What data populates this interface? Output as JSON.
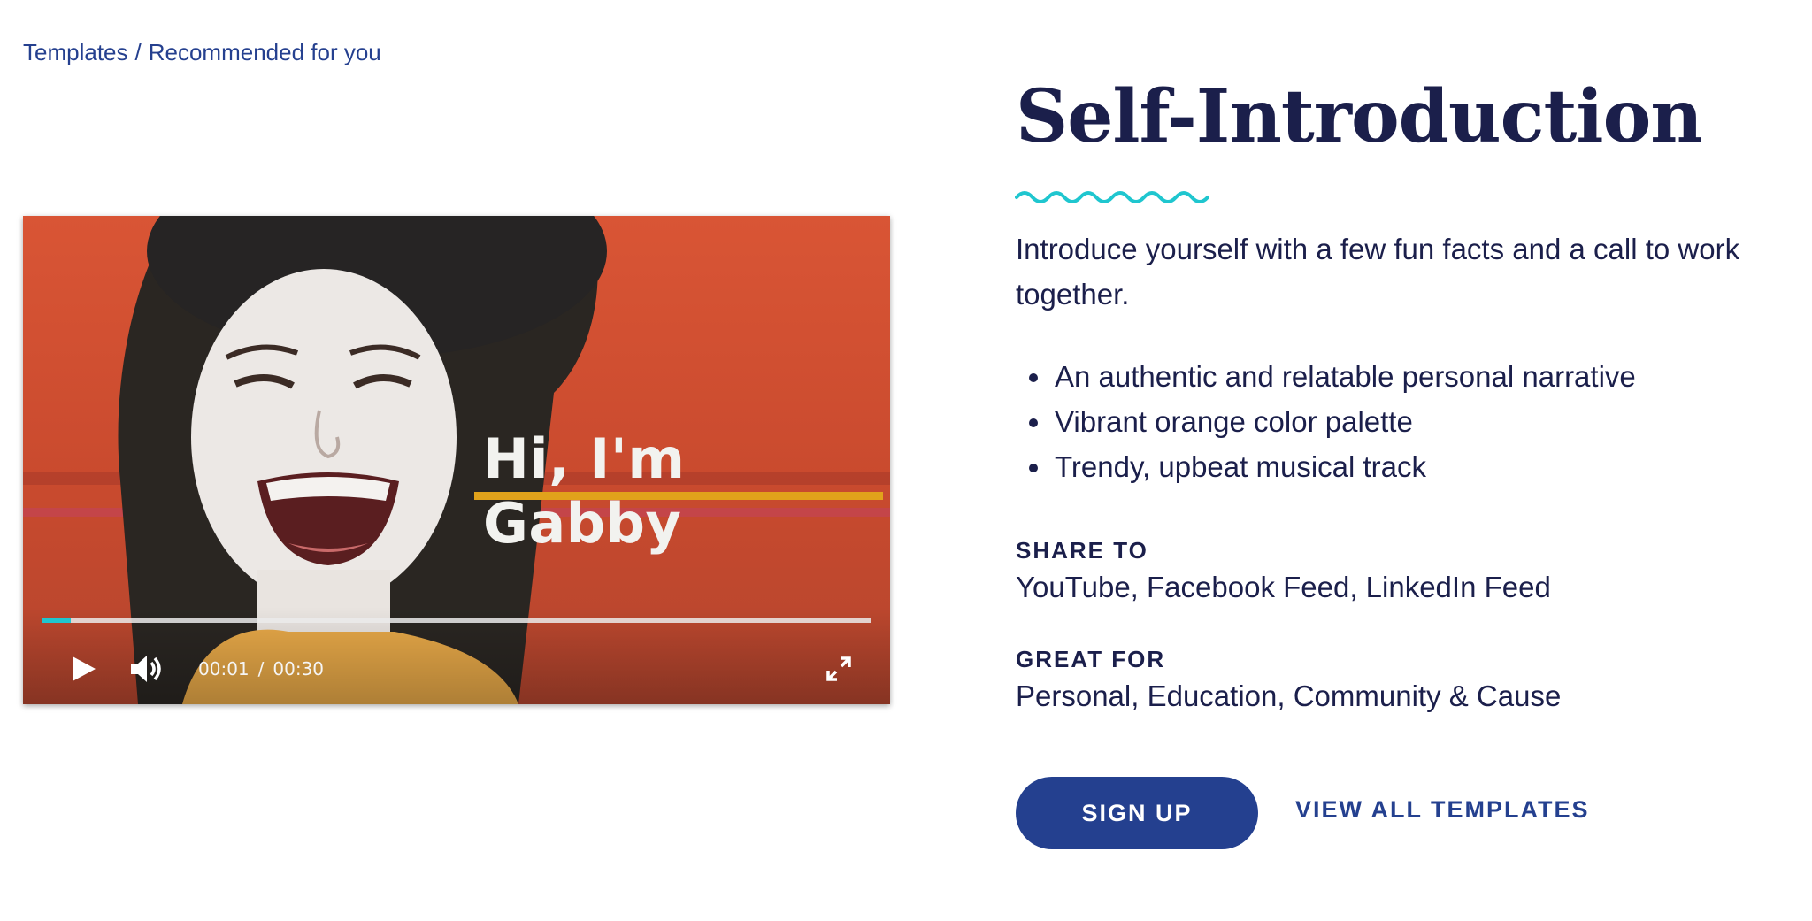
{
  "breadcrumb": {
    "root": "Templates",
    "separator": "/",
    "current": "Recommended for you"
  },
  "video": {
    "overlay_text": "Hi, I'm Gabby",
    "current_time": "00:01",
    "time_separator": "/",
    "duration": "00:30",
    "progress_fraction": 0.035,
    "icons": {
      "play": "play-icon",
      "volume": "volume-icon",
      "fullscreen": "fullscreen-icon"
    }
  },
  "template": {
    "title": "Self-Introduction",
    "description": "Introduce yourself with a few fun facts and a call to work together.",
    "features": [
      "An authentic and relatable personal narrative",
      "Vibrant orange color palette",
      "Trendy, upbeat musical track"
    ],
    "share_to": {
      "label": "SHARE TO",
      "value": "YouTube, Facebook Feed, LinkedIn Feed"
    },
    "great_for": {
      "label": "GREAT FOR",
      "value": "Personal, Education, Community & Cause"
    }
  },
  "actions": {
    "signup_label": "SIGN UP",
    "view_all_label": "VIEW ALL TEMPLATES"
  },
  "colors": {
    "accent": "#24408f",
    "wave": "#1fc6cf",
    "text": "#1b1f4b",
    "video_bg": "#d95535",
    "progress_fill": "#1fc6cf"
  }
}
